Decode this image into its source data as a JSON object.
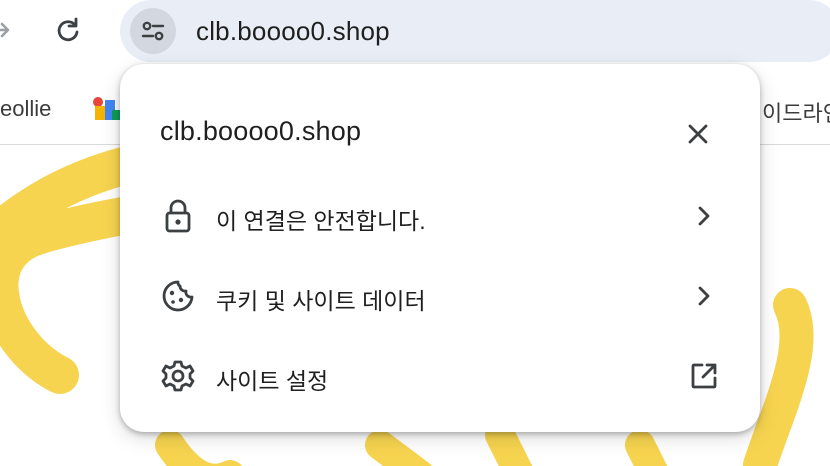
{
  "browser": {
    "url": "clb.boooo0.shop",
    "icons": {
      "forward": "forward-arrow-icon",
      "reload": "reload-icon",
      "site_info": "tune-icon"
    }
  },
  "bookmarks": {
    "left_item_label": "eollie",
    "right_item_label": "이드라인"
  },
  "popup": {
    "title": "clb.boooo0.shop",
    "items": [
      {
        "label": "이 연결은 안전합니다.",
        "icon": "lock-icon",
        "trailing": "chevron-right-icon"
      },
      {
        "label": "쿠키 및 사이트 데이터",
        "icon": "cookie-icon",
        "trailing": "chevron-right-icon"
      },
      {
        "label": "사이트 설정",
        "icon": "gear-icon",
        "trailing": "open-in-new-icon"
      }
    ]
  },
  "colors": {
    "omnibox_bg": "#e9edf6",
    "accent_yellow": "#f7d44f",
    "text": "#1f1f1f"
  }
}
